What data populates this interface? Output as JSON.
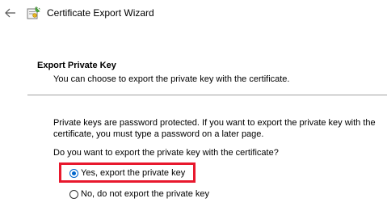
{
  "window": {
    "title": "Certificate Export Wizard"
  },
  "icons": {
    "back": "arrow-left-icon",
    "wizard": "certificate-wizard-icon"
  },
  "section": {
    "header": "Export Private Key",
    "subtitle": "You can choose to export the private key with the certificate."
  },
  "body": {
    "info_line_1": "Private keys are password protected. If you want to export the private key with the",
    "info_line_2": "certificate, you must type a password on a later page.",
    "question": "Do you want to export the private key with the certificate?"
  },
  "options": [
    {
      "label": "Yes, export the private key",
      "selected": true
    },
    {
      "label": "No, do not export the private key",
      "selected": false
    }
  ],
  "colors": {
    "highlight": "#e8182d",
    "radio_selected": "#0066cc",
    "divider": "#a0a0a0"
  }
}
